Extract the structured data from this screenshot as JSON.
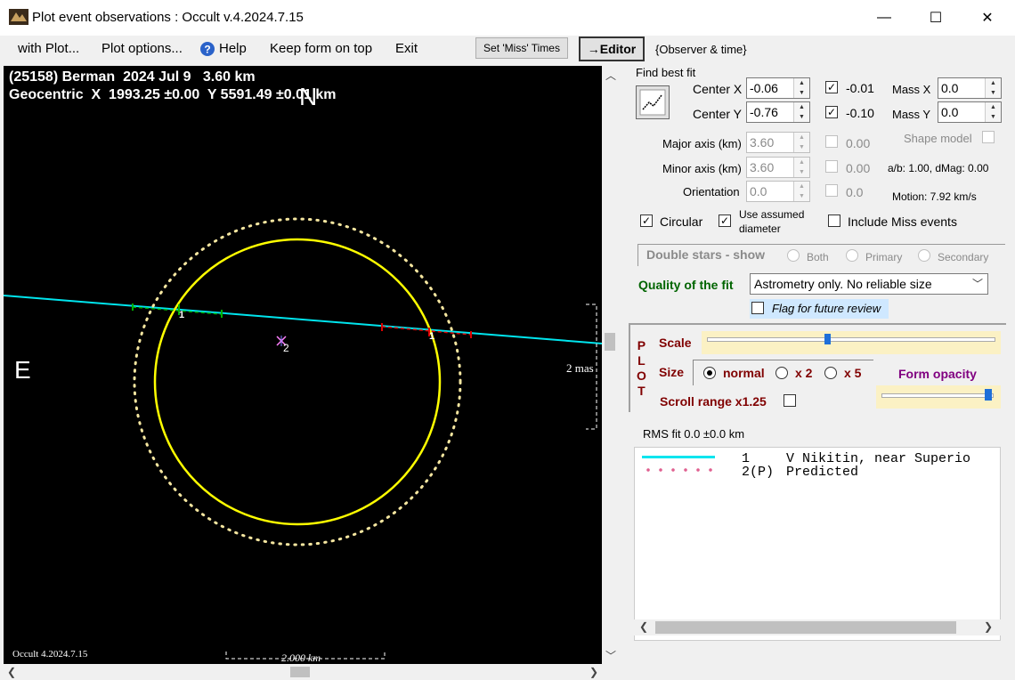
{
  "window": {
    "title": "Plot event observations : Occult v.4.2024.7.15",
    "minimize": "—",
    "maximize": "☐",
    "close": "✕"
  },
  "menu": {
    "with_plot": "with Plot...",
    "plot_options": "Plot options...",
    "help": "Help",
    "keep_on_top": "Keep form on top",
    "exit": "Exit",
    "set_miss_times": "Set 'Miss' Times",
    "editor": "→Editor",
    "observer_time": "{Observer & time}"
  },
  "plot": {
    "header_line1": "(25158) Berman  2024 Jul 9   3.60 km",
    "header_line2": "Geocentric  X  1993.25 ±0.00  Y 5591.49 ±0.01 km",
    "north": "N",
    "east": "E",
    "chord1_label": "1",
    "chord1b_label": "1",
    "center_label": "2",
    "mas_label": "2 mas",
    "scale_label": "2.000 km",
    "footer": "Occult 4.2024.7.15",
    "colors": {
      "background": "#000000",
      "ellipse": "#ffff00",
      "chord": "#00e5ee",
      "dotted": "#ffffff"
    }
  },
  "fit": {
    "find_best_fit": "Find best fit",
    "center_x_label": "Center X",
    "center_x_value": "-0.06",
    "center_x_check": "-0.01",
    "center_y_label": "Center Y",
    "center_y_value": "-0.76",
    "center_y_check": "-0.10",
    "mass_x_label": "Mass X",
    "mass_x_value": "0.0",
    "mass_y_label": "Mass Y",
    "mass_y_value": "0.0",
    "major_axis_label": "Major axis (km)",
    "major_axis_value": "3.60",
    "major_axis_check": "0.00",
    "minor_axis_label": "Minor axis (km)",
    "minor_axis_value": "3.60",
    "minor_axis_check": "0.00",
    "orientation_label": "Orientation",
    "orientation_value": "0.0",
    "orientation_check": "0.0",
    "shape_model": "Shape model",
    "ab_dmag": "a/b: 1.00, dMag: 0.00",
    "motion": "Motion: 7.92 km/s",
    "circular": "Circular",
    "use_assumed": "Use assumed",
    "diameter": "diameter",
    "include_miss": "Include Miss events",
    "double_stars": "Double stars - show",
    "both": "Both",
    "primary": "Primary",
    "secondary": "Secondary",
    "quality_label": "Quality of the fit",
    "quality_value": "Astrometry only. No reliable size",
    "flag_review": "Flag for future review"
  },
  "plotctl": {
    "side_letters": [
      "P",
      "L",
      "O",
      "T"
    ],
    "scale": "Scale",
    "size": "Size",
    "normal": "normal",
    "x2": "x 2",
    "x5": "x 5",
    "form_opacity": "Form opacity",
    "scroll_range": "Scroll range x1.25",
    "scale_position": 0.42,
    "opacity_position": 0.97
  },
  "rms": "RMS fit  0.0 ±0.0 km",
  "legend": [
    {
      "num": "1",
      "name": "V Nikitin, near Superio"
    },
    {
      "num": "2(P)",
      "name": "Predicted"
    }
  ]
}
